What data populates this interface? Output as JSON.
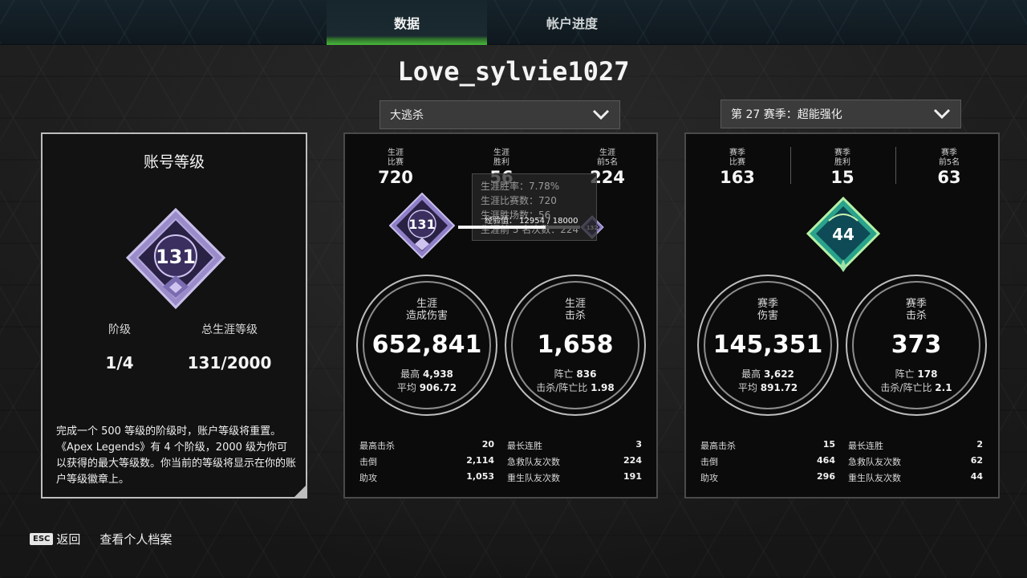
{
  "tabs": [
    {
      "label": "数据",
      "active": true
    },
    {
      "label": "帐户进度",
      "active": false
    }
  ],
  "username": "Love_sylvie1027",
  "dropdowns": {
    "mode": {
      "value": "大逃杀"
    },
    "season": {
      "value": "第 27 赛季：超能强化"
    }
  },
  "account_level": {
    "title": "账号等级",
    "badge_level": "131",
    "labels": {
      "tier": "阶级",
      "total": "总生涯等级"
    },
    "tier": "1/4",
    "total": "131/2000",
    "description": "完成一个 500 等级的阶级时，账户等级将重置。《Apex Legends》有 4 个阶级，2000 级为你可以获得的最大等级数。你当前的等级将显示在你的账户等级徽章上。"
  },
  "career": {
    "top": [
      {
        "label": "生涯\n比赛",
        "value": "720"
      },
      {
        "label": "生涯\n胜利",
        "value": "56"
      },
      {
        "label": "生涯\n前5名",
        "value": "224"
      }
    ],
    "badge_level": "131",
    "next_level": "132",
    "xp": {
      "text": "经验值： 12954 / 18000",
      "fraction": 0.7197
    },
    "tooltip": [
      "生涯胜率：7.78%",
      "生涯比赛数：720",
      "生涯胜场数：56",
      "生涯前 5 名次数：224"
    ],
    "damage": {
      "label": "生涯\n造成伤害",
      "value": "652,841",
      "high_label": "最高",
      "high": "4,938",
      "avg_label": "平均",
      "avg": "906.72"
    },
    "kills": {
      "label": "生涯\n击杀",
      "value": "1,658",
      "deaths_label": "阵亡",
      "deaths": "836",
      "kd_label": "击杀/阵亡比",
      "kd": "1.98"
    },
    "table": [
      {
        "l1": "最高击杀",
        "v1": "20",
        "l2": "最长连胜",
        "v2": "3"
      },
      {
        "l1": "击倒",
        "v1": "2,114",
        "l2": "急救队友次数",
        "v2": "224"
      },
      {
        "l1": "助攻",
        "v1": "1,053",
        "l2": "重生队友次数",
        "v2": "191"
      }
    ]
  },
  "season": {
    "top": [
      {
        "label": "赛季\n比赛",
        "value": "163"
      },
      {
        "label": "赛季\n胜利",
        "value": "15"
      },
      {
        "label": "赛季\n前5名",
        "value": "63"
      }
    ],
    "badge_level": "44",
    "damage": {
      "label": "赛季\n伤害",
      "value": "145,351",
      "high_label": "最高",
      "high": "3,622",
      "avg_label": "平均",
      "avg": "891.72"
    },
    "kills": {
      "label": "赛季\n击杀",
      "value": "373",
      "deaths_label": "阵亡",
      "deaths": "178",
      "kd_label": "击杀/阵亡比",
      "kd": "2.1"
    },
    "table": [
      {
        "l1": "最高击杀",
        "v1": "15",
        "l2": "最长连胜",
        "v2": "2"
      },
      {
        "l1": "击倒",
        "v1": "464",
        "l2": "急救队友次数",
        "v2": "62"
      },
      {
        "l1": "助攻",
        "v1": "296",
        "l2": "重生队友次数",
        "v2": "44"
      }
    ]
  },
  "footer": {
    "esc_key": "ESC",
    "back": "返回",
    "profile": "查看个人档案"
  },
  "colors": {
    "accent_green": "#48b93a",
    "badge_purple": "#8f7fc8",
    "season_teal": "#2aa38c"
  }
}
